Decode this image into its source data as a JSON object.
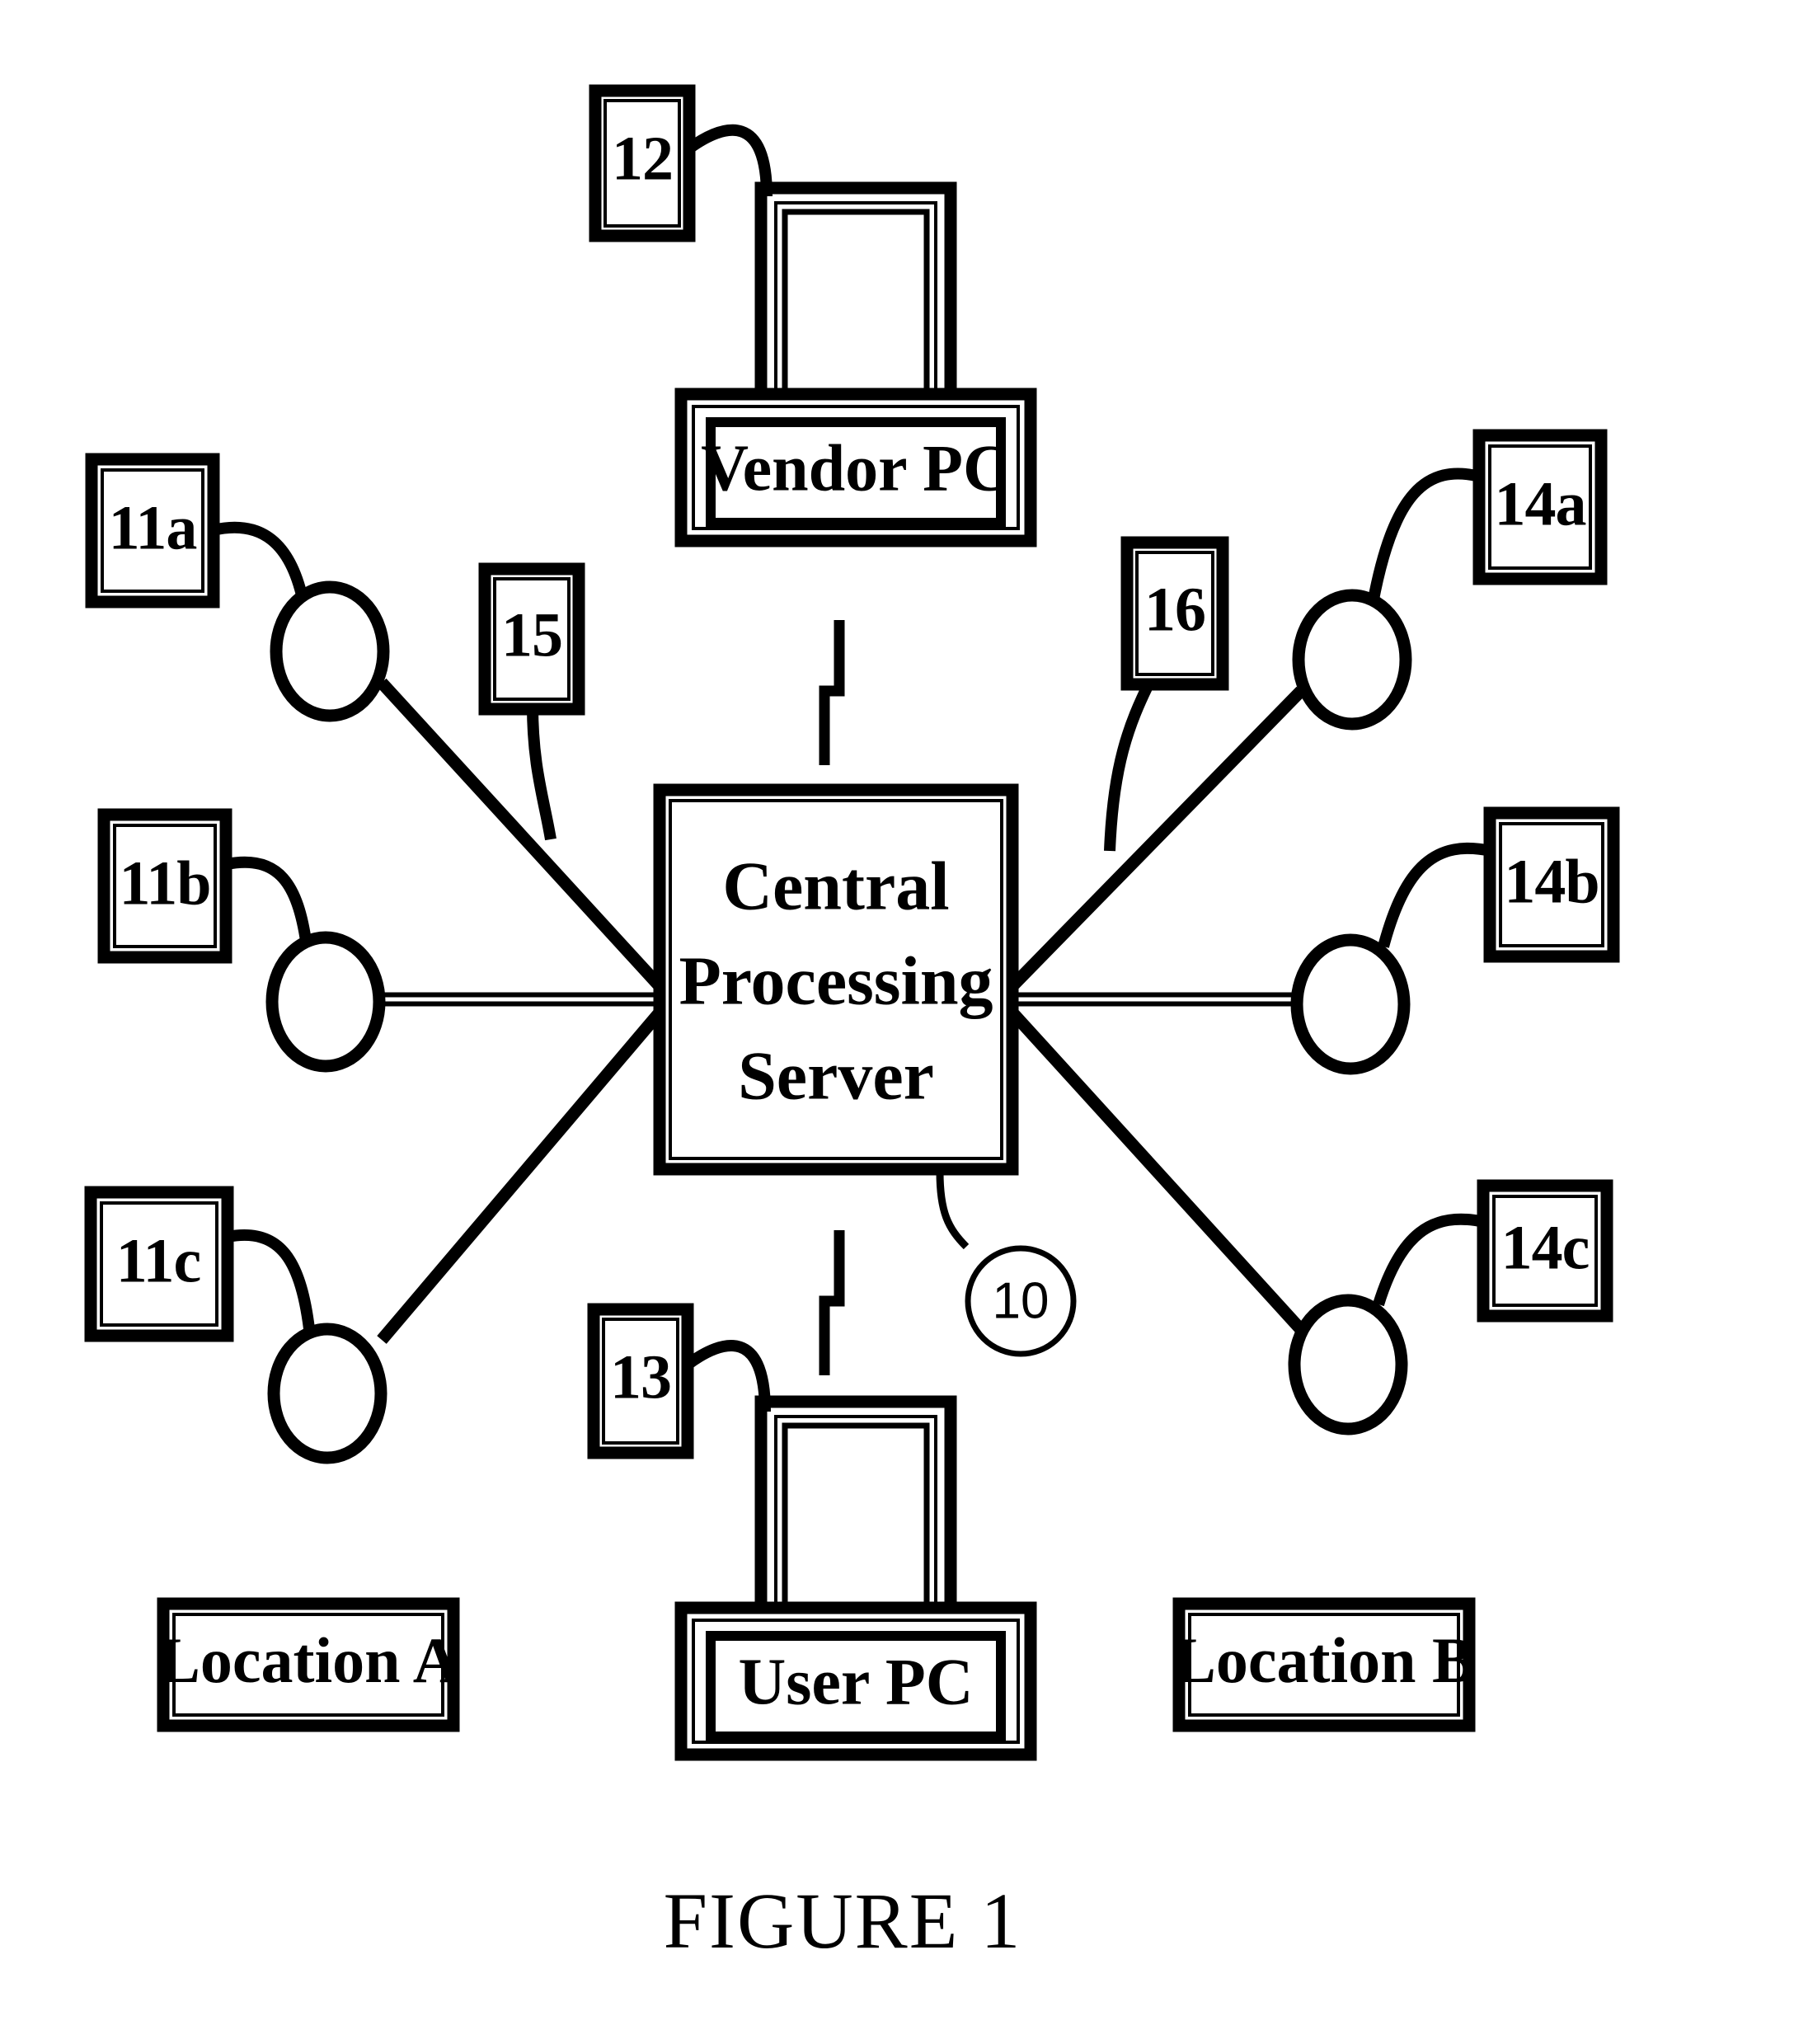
{
  "figure": {
    "caption": "FIGURE 1",
    "central_node": {
      "label_line1": "Central",
      "label_line2": "Processing",
      "label_line3": "Server",
      "ref": "10"
    },
    "computers": [
      {
        "id": "vendor-pc",
        "label": "Vendor PC",
        "ref": "12",
        "position": "top"
      },
      {
        "id": "user-pc",
        "label": "User PC",
        "ref": "13",
        "position": "bottom"
      }
    ],
    "left_terminals": [
      {
        "id": "terminal-11a",
        "ref": "11a"
      },
      {
        "id": "terminal-11b",
        "ref": "11b"
      },
      {
        "id": "terminal-11c",
        "ref": "11c"
      }
    ],
    "right_terminals": [
      {
        "id": "terminal-14a",
        "ref": "14a"
      },
      {
        "id": "terminal-14b",
        "ref": "14b"
      },
      {
        "id": "terminal-14c",
        "ref": "14c"
      }
    ],
    "link_refs": [
      {
        "id": "link-15",
        "ref": "15",
        "side": "left"
      },
      {
        "id": "link-16",
        "ref": "16",
        "side": "right"
      }
    ],
    "locations": [
      {
        "id": "location-a",
        "label": "Location A"
      },
      {
        "id": "location-b",
        "label": "Location B"
      }
    ],
    "colors": {
      "ink": "#000000",
      "paper": "#ffffff"
    }
  }
}
